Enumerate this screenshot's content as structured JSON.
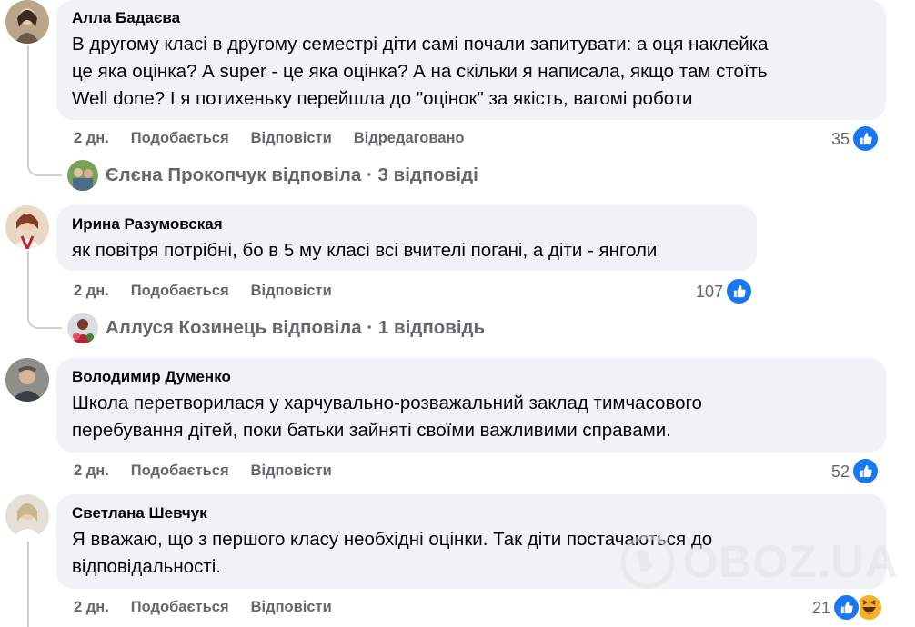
{
  "comments": [
    {
      "author": "Алла Бадаєва",
      "lines": [
        "В другому класі в другому семестрі діти самі почали запитувати: а оця наклейка",
        "це яка оцінка? А super - це яка оцінка? А на скільки я написала, якщо там стоїть",
        "Well done? І я потихеньку перейшла до \"оцінок\" за якість, вагомі роботи"
      ],
      "time": "2 дн.",
      "like_label": "Подобається",
      "reply_label": "Відповісти",
      "edited_label": "Відредаговано",
      "reactions": "35",
      "reply_summary": "Єлєна Прокопчук відповіла · 3 відповіді"
    },
    {
      "author": "Ирина Разумовская",
      "lines": [
        "як повітря потрібні, бо в 5 му класі всі вчителі погані, а діти - янголи"
      ],
      "time": "2 дн.",
      "like_label": "Подобається",
      "reply_label": "Відповісти",
      "reactions": "107",
      "reply_summary": "Аллуся Козинець відповіла · 1 відповідь"
    },
    {
      "author": "Володимир Думенко",
      "lines": [
        "Школа перетворилася у харчувально-розважальний заклад тимчасового",
        "перебування дітей, поки батьки зайняті своїми важливими справами."
      ],
      "time": "2 дн.",
      "like_label": "Подобається",
      "reply_label": "Відповісти",
      "reactions": "52"
    },
    {
      "author": "Светлана Шевчук",
      "lines": [
        "Я вважаю, що з першого класу необхідні оцінки. Так діти постачаються до",
        "відповідальності."
      ],
      "time": "2 дн.",
      "like_label": "Подобається",
      "reply_label": "Відповісти",
      "reactions": "21"
    }
  ],
  "watermark": "OBOZ.UA",
  "colors": {
    "bubble": "#f0f2f5",
    "meta_text": "#65676b",
    "like_blue": "#1877f2",
    "haha_yellow": "#f7b125"
  },
  "icons": [
    "like-icon",
    "haha-icon"
  ]
}
